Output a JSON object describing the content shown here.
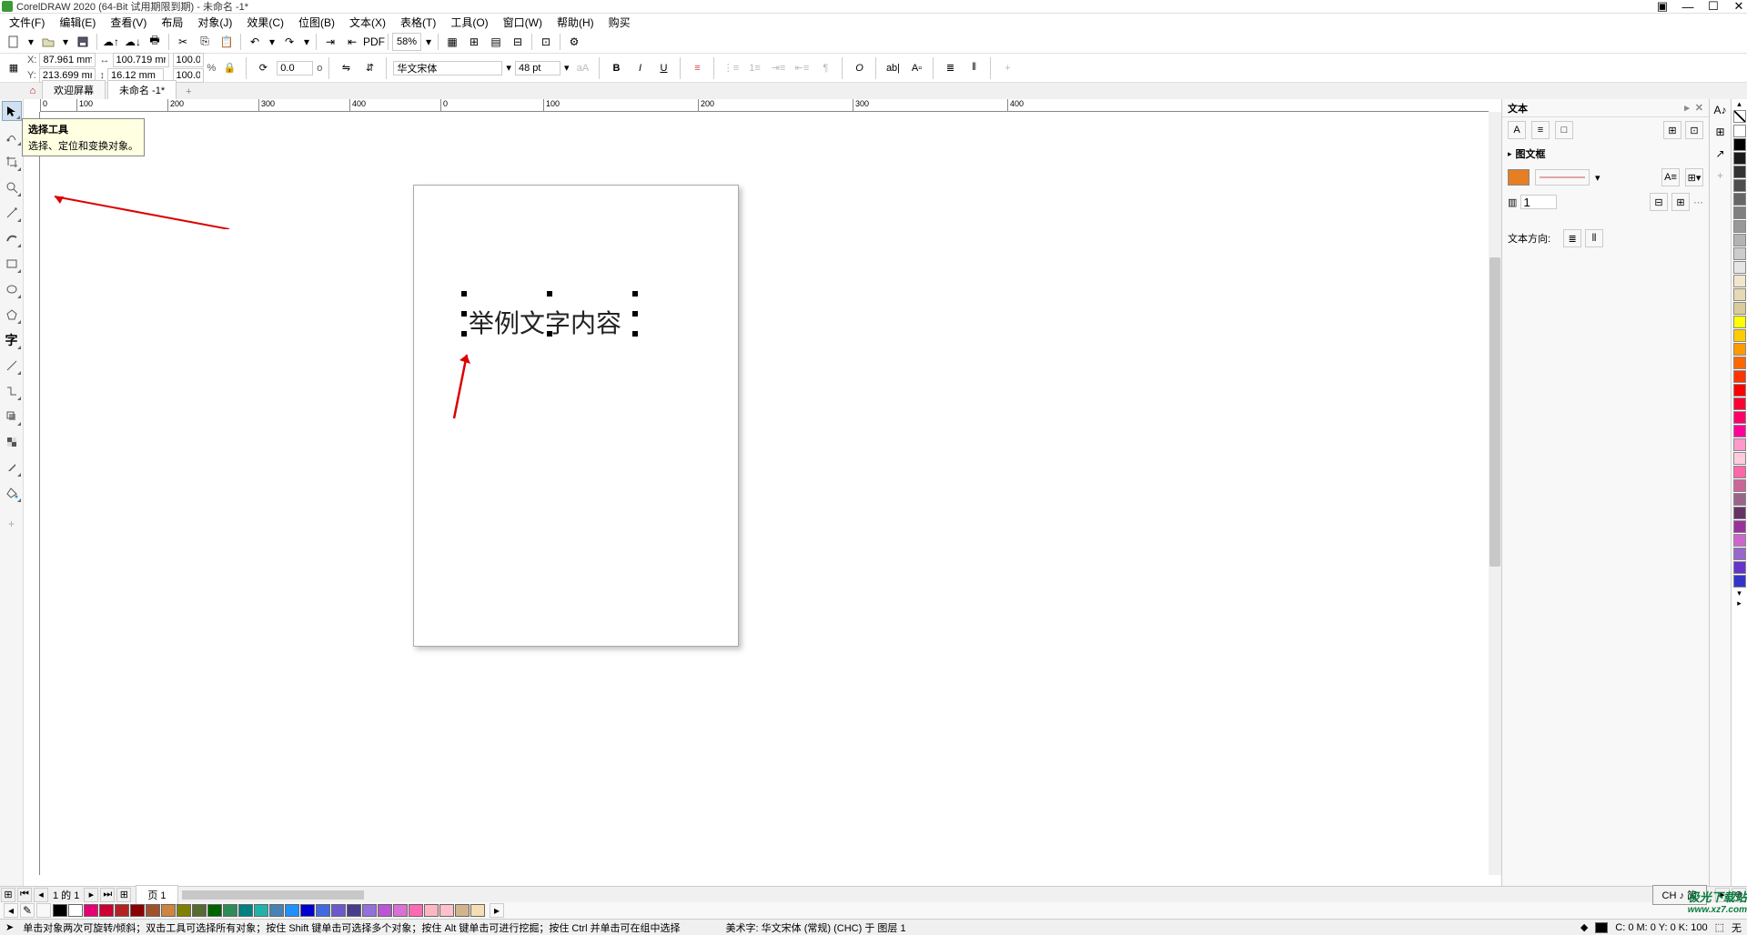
{
  "title": "CorelDRAW 2020 (64-Bit 试用期限到期) - 未命名 -1*",
  "menu": [
    "文件(F)",
    "编辑(E)",
    "查看(V)",
    "布局",
    "对象(J)",
    "效果(C)",
    "位图(B)",
    "文本(X)",
    "表格(T)",
    "工具(O)",
    "窗口(W)",
    "帮助(H)",
    "购买"
  ],
  "toolbar1": {
    "zoom": "58%"
  },
  "prop": {
    "x": "87.961 mm",
    "y": "213.699 mm",
    "w": "100.719 mm",
    "h": "16.12 mm",
    "sx": "100.0",
    "sy": "100.0",
    "pct": "%",
    "rot": "0.0",
    "deg": "o",
    "font": "华文宋体",
    "size": "48 pt"
  },
  "tabs": {
    "welcome": "欢迎屏幕",
    "doc": "未命名 -1*"
  },
  "canvas_text": "举例文字内容",
  "tooltip": {
    "title": "选择工具",
    "desc": "选择、定位和变换对象。"
  },
  "docker": {
    "title": "文本",
    "section1": "图文框",
    "columns_val": "1",
    "textdir_label": "文本方向:"
  },
  "pagenav": {
    "counter": "1 的 1",
    "page1": "页 1",
    "ime": "CH ♪ 简"
  },
  "status": {
    "hint": "单击对象两次可旋转/倾斜；双击工具可选择所有对象；按住 Shift 键单击可选择多个对象；按住 Alt 键单击可进行挖掘；按住 Ctrl 并单击可在组中选择",
    "objinfo": "美术字: 华文宋体 (常规) (CHC) 于 图层 1",
    "cmyk": "C: 0 M: 0 Y: 0 K: 100",
    "outline": "无"
  },
  "watermark": {
    "main": "极光下载站",
    "sub": "www.xz7.com"
  },
  "palette_colors": [
    "#ffffff",
    "#000000",
    "#1a1a1a",
    "#333333",
    "#4d4d4d",
    "#666666",
    "#808080",
    "#999999",
    "#b3b3b3",
    "#cccccc",
    "#e6e6e6",
    "#f2e6cc",
    "#e6d9b3",
    "#d9cc99",
    "#ffff00",
    "#ffcc00",
    "#ff9900",
    "#ff6600",
    "#ff3300",
    "#ff0000",
    "#ff0033",
    "#ff0066",
    "#ff0099",
    "#ff99cc",
    "#ffccdd",
    "#ff66aa",
    "#cc6699",
    "#996688",
    "#663366",
    "#993399",
    "#cc66cc",
    "#9966cc",
    "#6633cc",
    "#3333cc"
  ],
  "bottom_colors": [
    "#000000",
    "#ffffff",
    "#e60073",
    "#cc0033",
    "#b22222",
    "#8b0000",
    "#a0522d",
    "#cd853f",
    "#808000",
    "#556b2f",
    "#006400",
    "#2e8b57",
    "#008080",
    "#20b2aa",
    "#4682b4",
    "#1e90ff",
    "#0000cd",
    "#4169e1",
    "#6a5acd",
    "#483d8b",
    "#9370db",
    "#ba55d3",
    "#da70d6",
    "#ff69b4",
    "#ffb6c1",
    "#ffc0cb",
    "#d2b48c",
    "#f5deb3"
  ]
}
